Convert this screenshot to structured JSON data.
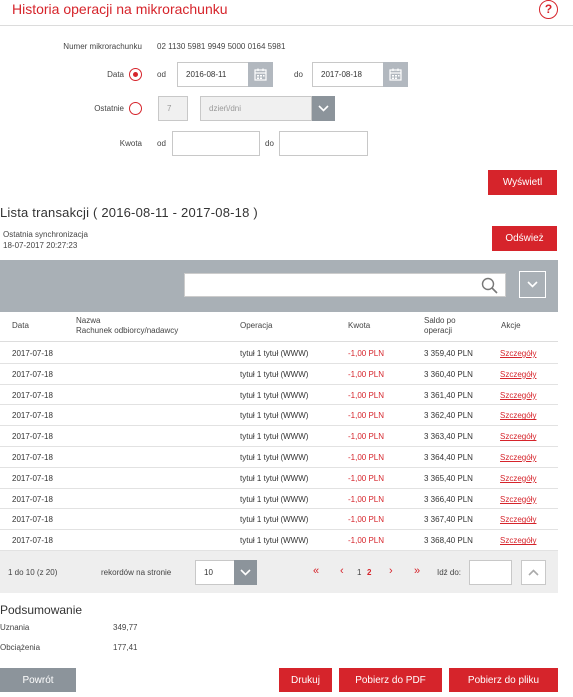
{
  "header": {
    "title": "Historia operacji na mikrorachunku",
    "help": "?"
  },
  "form": {
    "account_label": "Numer mikrorachunku",
    "account_number": "02 1130 5981 9949 5000 0164 5981",
    "date_label": "Data",
    "from_label": "od",
    "to_label": "do",
    "date_from": "2016-08-11",
    "date_to": "2017-08-18",
    "last_label": "Ostatnie",
    "last_value": "7",
    "last_unit": "dzień/dni",
    "amount_label": "Kwota",
    "amount_from_label": "od",
    "amount_to_label": "do",
    "amount_from": "",
    "amount_to": "",
    "show_button": "Wyświetl"
  },
  "list": {
    "title": "Lista transakcji  ( 2016-08-11  -  2017-08-18 )",
    "sync_label": "Ostatnia synchronizacja",
    "sync_time": "18-07-2017 20:27:23",
    "refresh_button": "Odśwież",
    "search_value": ""
  },
  "table": {
    "headers": {
      "date": "Data",
      "name_line1": "Nazwa",
      "name_line2": "Rachunek odbiorcy/nadawcy",
      "operation": "Operacja",
      "amount": "Kwota",
      "balance_line1": "Saldo po",
      "balance_line2": "operacji",
      "actions": "Akcje"
    },
    "rows": [
      {
        "date": "2017-07-18",
        "name": "",
        "operation": "tytuł 1 tytuł (WWW)",
        "amount": "-1,00 PLN",
        "balance": "3 359,40 PLN",
        "action": "Szczegóły"
      },
      {
        "date": "2017-07-18",
        "name": "",
        "operation": "tytuł 1 tytuł (WWW)",
        "amount": "-1,00 PLN",
        "balance": "3 360,40 PLN",
        "action": "Szczegóły"
      },
      {
        "date": "2017-07-18",
        "name": "",
        "operation": "tytuł 1 tytuł (WWW)",
        "amount": "-1,00 PLN",
        "balance": "3 361,40 PLN",
        "action": "Szczegóły"
      },
      {
        "date": "2017-07-18",
        "name": "",
        "operation": "tytuł 1 tytuł (WWW)",
        "amount": "-1,00 PLN",
        "balance": "3 362,40 PLN",
        "action": "Szczegóły"
      },
      {
        "date": "2017-07-18",
        "name": "",
        "operation": "tytuł 1 tytuł (WWW)",
        "amount": "-1,00 PLN",
        "balance": "3 363,40 PLN",
        "action": "Szczegóły"
      },
      {
        "date": "2017-07-18",
        "name": "",
        "operation": "tytuł 1 tytuł (WWW)",
        "amount": "-1,00 PLN",
        "balance": "3 364,40 PLN",
        "action": "Szczegóły"
      },
      {
        "date": "2017-07-18",
        "name": "",
        "operation": "tytuł 1 tytuł (WWW)",
        "amount": "-1,00 PLN",
        "balance": "3 365,40 PLN",
        "action": "Szczegóły"
      },
      {
        "date": "2017-07-18",
        "name": "",
        "operation": "tytuł 1 tytuł (WWW)",
        "amount": "-1,00 PLN",
        "balance": "3 366,40 PLN",
        "action": "Szczegóły"
      },
      {
        "date": "2017-07-18",
        "name": "",
        "operation": "tytuł 1 tytuł (WWW)",
        "amount": "-1,00 PLN",
        "balance": "3 367,40 PLN",
        "action": "Szczegóły"
      },
      {
        "date": "2017-07-18",
        "name": "",
        "operation": "tytuł 1 tytuł (WWW)",
        "amount": "-1,00 PLN",
        "balance": "3 368,40 PLN",
        "action": "Szczegóły"
      }
    ]
  },
  "pagination": {
    "range": "1 do 10 (z 20)",
    "per_page_label": "rekordów na stronie",
    "per_page": "10",
    "first": "«",
    "prev": "‹",
    "page1": "1",
    "page2": "2",
    "next": "›",
    "last": "»",
    "goto_label": "Idź do:",
    "goto_value": ""
  },
  "summary": {
    "title": "Podsumowanie",
    "credits_label": "Uznania",
    "credits_value": "349,77",
    "debits_label": "Obciążenia",
    "debits_value": "177,41"
  },
  "footer": {
    "back": "Powrót",
    "print": "Drukuj",
    "pdf": "Pobierz do PDF",
    "file": "Pobierz do pliku"
  },
  "colors": {
    "accent": "#d6242b",
    "toolbar": "#a9b0b6",
    "button_gray": "#8c949b"
  },
  "icons": [
    "help-icon",
    "calendar-icon",
    "chevron-down-icon",
    "search-icon",
    "chevron-up-icon"
  ]
}
